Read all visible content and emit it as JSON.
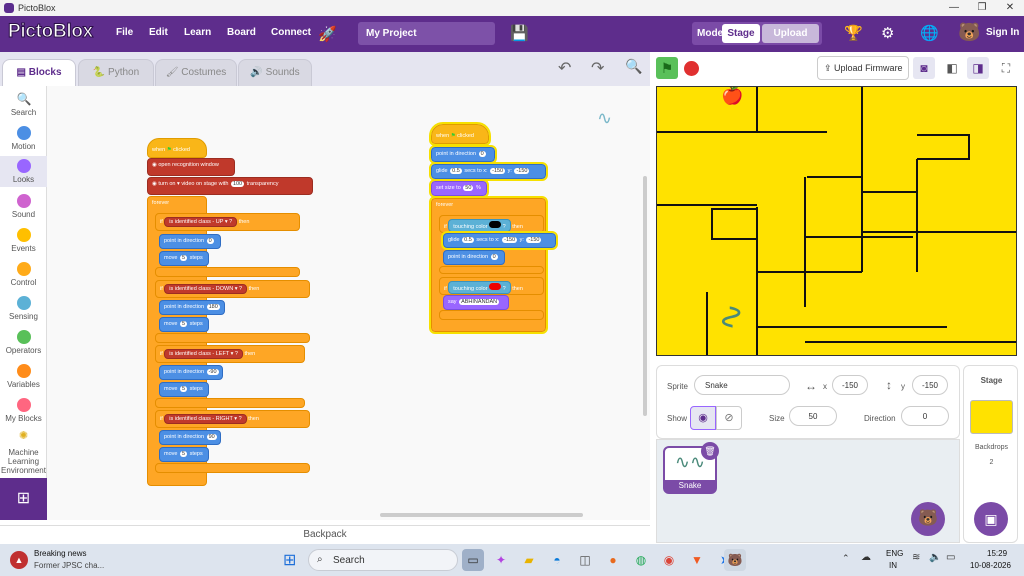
{
  "window": {
    "title": "PictoBlox",
    "min_icon": "minimize-icon",
    "max_icon": "restore-icon",
    "close_icon": "close-icon"
  },
  "menubar": {
    "logo": "PictoBlox",
    "items": [
      "File",
      "Edit",
      "Learn",
      "Board",
      "Connect"
    ],
    "project_name": "My Project",
    "mode_label": "Mode",
    "mode_stage": "Stage",
    "mode_upload": "Upload",
    "sign_in": "Sign In"
  },
  "tabs": [
    "Blocks",
    "Python",
    "Costumes",
    "Sounds"
  ],
  "categories": [
    {
      "label": "Search",
      "color": "#4a90e2"
    },
    {
      "label": "Motion",
      "color": "#4c8fe4"
    },
    {
      "label": "Looks",
      "color": "#9966ff"
    },
    {
      "label": "Sound",
      "color": "#cf63cf"
    },
    {
      "label": "Events",
      "color": "#ffbf00"
    },
    {
      "label": "Control",
      "color": "#ffab19"
    },
    {
      "label": "Sensing",
      "color": "#5cb1d6"
    },
    {
      "label": "Operators",
      "color": "#59c059"
    },
    {
      "label": "Variables",
      "color": "#ff8c1a"
    },
    {
      "label": "My Blocks",
      "color": "#ff6680"
    },
    {
      "label": "Machine Learning Environment",
      "color": "#f0c040"
    }
  ],
  "script1": {
    "hat": "when",
    "hat2": "clicked",
    "open": "open recognition window",
    "turn": "turn",
    "turn_on": "on ▾",
    "turn_mid": "video on stage with",
    "turn_val": "100",
    "turn_end": "transparency",
    "forever": "forever",
    "if": "if",
    "then": "then",
    "is_id": "is identified class -",
    "q": "?",
    "up": "UP ▾",
    "down": "DOWN ▾",
    "left": "LEFT ▾",
    "right": "RIGHT ▾",
    "point": "point in direction",
    "dir_up": "0",
    "dir_down": "180",
    "dir_left": "-90",
    "dir_right": "90",
    "move": "move",
    "steps": "steps",
    "move_val": "5"
  },
  "script2": {
    "hat": "when",
    "hat2": "clicked",
    "point": "point in direction",
    "dir0": "0",
    "glide": "glide",
    "glide_val": "0.5",
    "secs": "secs to x:",
    "gx": "-150",
    "y": "y:",
    "gy": "-150",
    "setsize": "set size to",
    "size_val": "50",
    "pct": "%",
    "forever": "forever",
    "if": "if",
    "then": "then",
    "touching": "touching color",
    "q": "?",
    "glide2": "glide",
    "glide2_val": "0.5",
    "gx2": "-150",
    "gy2": "-150",
    "dir2": "0",
    "say": "say",
    "say_val": "ABHINANDAN"
  },
  "backpack": "Backpack",
  "stage_toolbar": {
    "upload_firmware": "Upload Firmware"
  },
  "sprite": {
    "sprite_label": "Sprite",
    "sprite_name": "Snake",
    "x_label": "x",
    "x_val": "-150",
    "y_label": "y",
    "y_val": "-150",
    "show_label": "Show",
    "size_label": "Size",
    "size_val": "50",
    "direction_label": "Direction",
    "direction_val": "0",
    "thumb_label": "Snake"
  },
  "stage_pane": {
    "title": "Stage",
    "backdrops_label": "Backdrops",
    "backdrops_count": "2"
  },
  "taskbar": {
    "news_title": "Breaking news",
    "news_sub": "Former JPSC cha...",
    "search": "Search",
    "lang1": "ENG",
    "lang2": "IN",
    "time": "15:29",
    "date": "10-08-2026"
  }
}
